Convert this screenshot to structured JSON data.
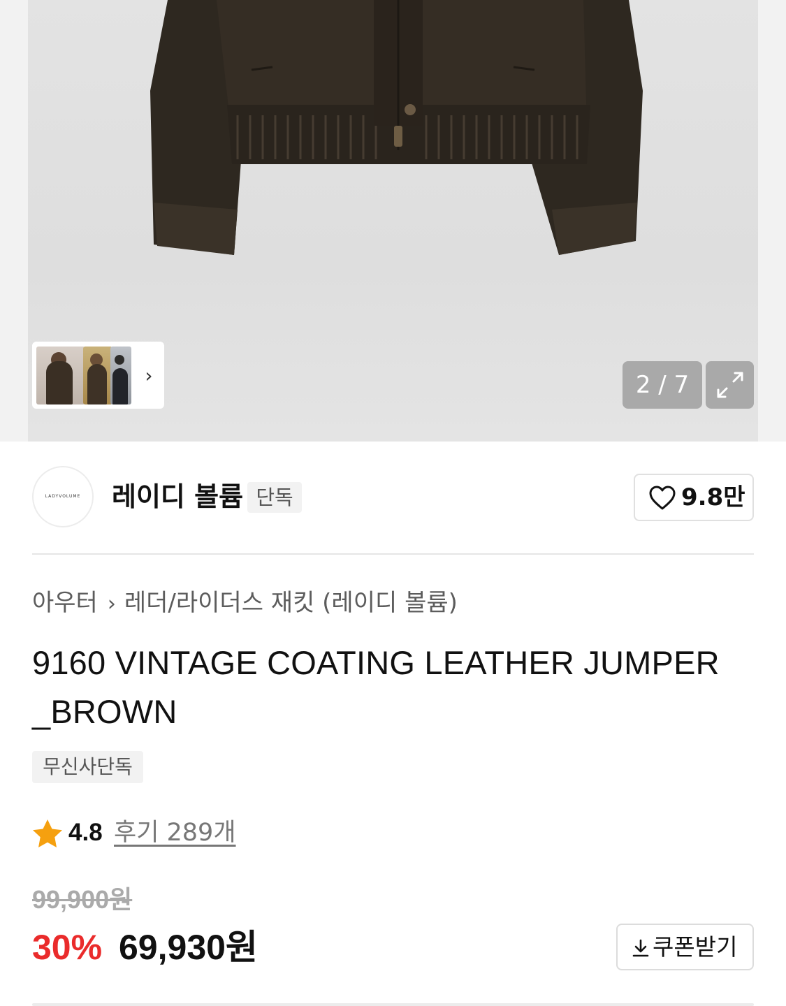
{
  "gallery": {
    "counter": "2 / 7"
  },
  "brand": {
    "logo_text": "LADYVOLUME",
    "name": "레이디 볼륨",
    "badge": "단독",
    "likes": "9.8만"
  },
  "breadcrumb": {
    "category": "아우터",
    "subcategory": "레더/라이더스 재킷 (레이디 볼륨)"
  },
  "product": {
    "title_line1": "9160 VINTAGE COATING LEATHER JUMPER",
    "title_line2": "_BROWN",
    "tag": "무신사단독"
  },
  "rating": {
    "score": "4.8",
    "reviews": "후기 289개"
  },
  "price": {
    "original": "99,900원",
    "discount": "30%",
    "sale": "69,930원",
    "coupon_label": "쿠폰받기"
  },
  "colors": {
    "discount_red": "#ea2b2b",
    "star_orange": "#f5a00f",
    "counter_bg": "#a9a9a9"
  },
  "icons": {
    "like": "heart-icon",
    "expand": "expand-icon",
    "next": "chevron-right-icon",
    "rating": "star-icon",
    "coupon": "download-icon"
  }
}
